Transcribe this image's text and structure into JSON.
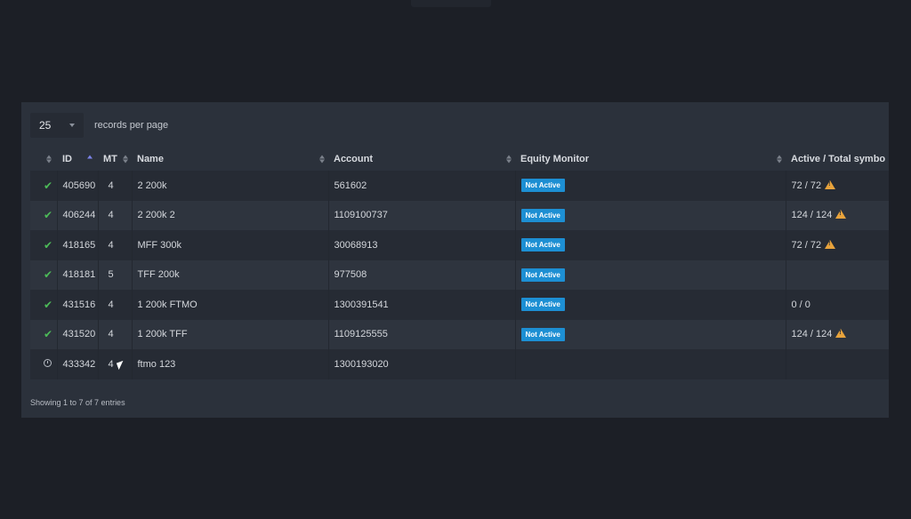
{
  "length_menu": {
    "value": "25",
    "label": "records per page"
  },
  "columns": [
    {
      "key": "status",
      "label": ""
    },
    {
      "key": "id",
      "label": "ID"
    },
    {
      "key": "mt",
      "label": "MT"
    },
    {
      "key": "name",
      "label": "Name"
    },
    {
      "key": "account",
      "label": "Account"
    },
    {
      "key": "equity",
      "label": "Equity Monitor"
    },
    {
      "key": "symbols",
      "label": "Active / Total symbo"
    }
  ],
  "rows": [
    {
      "status": "check-icon",
      "id": "405690",
      "mt": "4",
      "name": "2 200k",
      "account": "561602",
      "equity": "Not Active",
      "symbols": "72 / 72",
      "warning": true
    },
    {
      "status": "check-icon",
      "id": "406244",
      "mt": "4",
      "name": "2 200k 2",
      "account": "1109100737",
      "equity": "Not Active",
      "symbols": "124 / 124",
      "warning": true
    },
    {
      "status": "check-icon",
      "id": "418165",
      "mt": "4",
      "name": "MFF 300k",
      "account": "30068913",
      "equity": "Not Active",
      "symbols": "72 / 72",
      "warning": true
    },
    {
      "status": "check-icon",
      "id": "418181",
      "mt": "5",
      "name": "TFF 200k",
      "account": "977508",
      "equity": "Not Active",
      "symbols": "",
      "warning": false
    },
    {
      "status": "check-icon",
      "id": "431516",
      "mt": "4",
      "name": "1 200k FTMO",
      "account": "1300391541",
      "equity": "Not Active",
      "symbols": "0 / 0",
      "warning": false
    },
    {
      "status": "check-icon",
      "id": "431520",
      "mt": "4",
      "name": "1 200k TFF",
      "account": "1109125555",
      "equity": "Not Active",
      "symbols": "124 / 124",
      "warning": true
    },
    {
      "status": "clock-icon",
      "id": "433342",
      "mt": "4",
      "name": "ftmo 123",
      "account": "1300193020",
      "equity": "",
      "symbols": "",
      "warning": false
    }
  ],
  "footer": {
    "info": "Showing 1 to 7 of 7 entries"
  },
  "colors": {
    "badge": "#1d8fd3",
    "check": "#4cbb58",
    "warning": "#e8a33c",
    "panel": "#2b313b"
  }
}
